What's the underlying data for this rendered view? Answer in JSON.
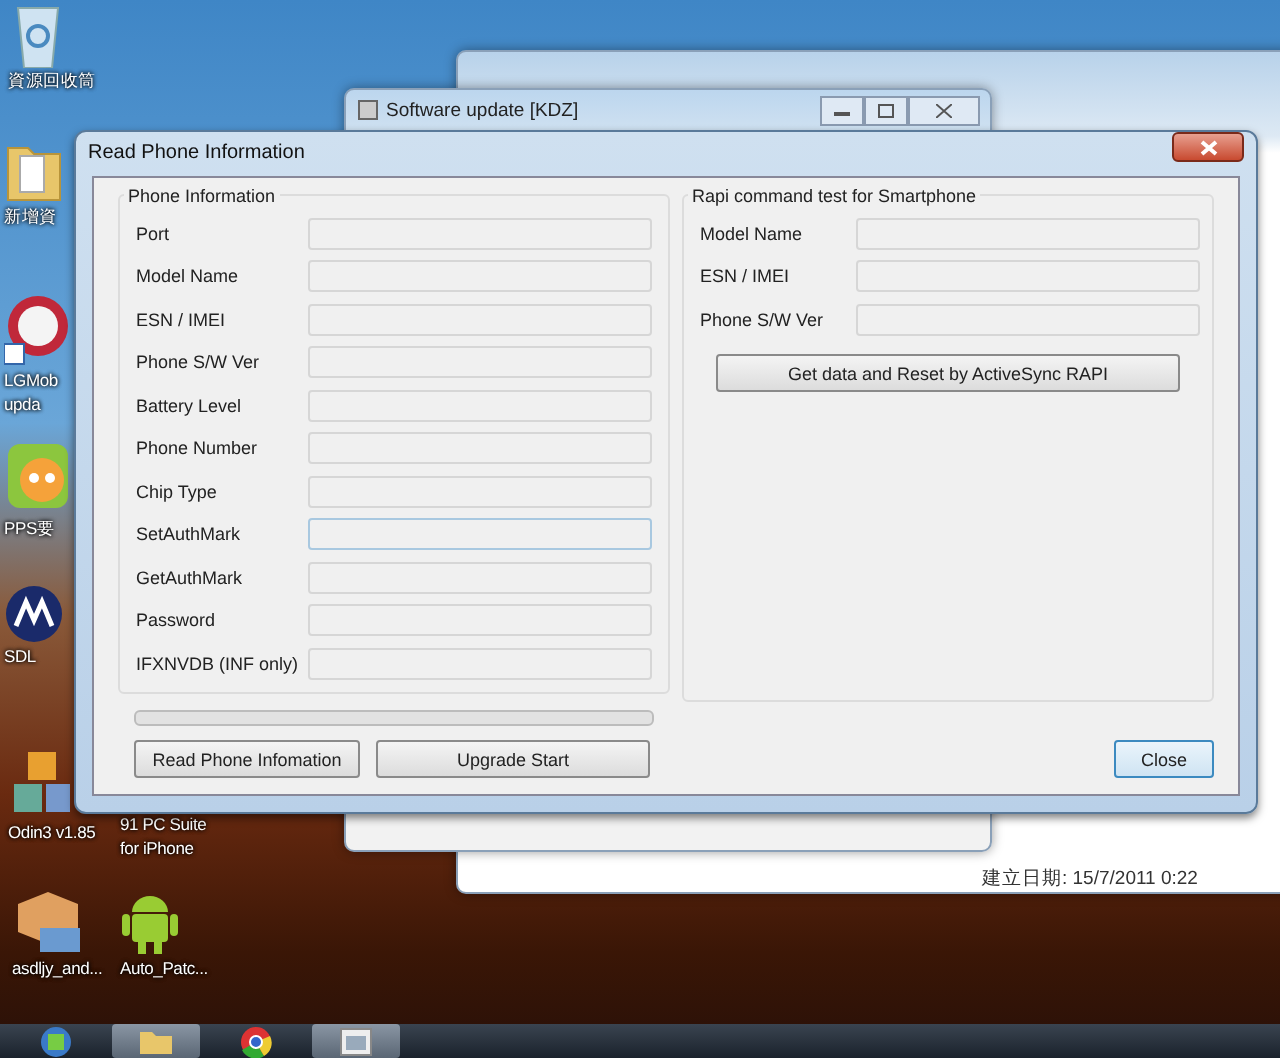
{
  "desktop_icons": [
    {
      "kind": "recycle",
      "lines": [
        "資源回收筒"
      ]
    },
    {
      "kind": "folder",
      "lines": [
        "新增資"
      ]
    },
    {
      "kind": "lg",
      "lines": [
        "LGMob",
        "upda"
      ]
    },
    {
      "kind": "pps",
      "lines": [
        "PPS要"
      ]
    },
    {
      "kind": "moto",
      "lines": [
        "SDL"
      ]
    },
    {
      "kind": "odin",
      "lines": [
        "Odin3 v1.85"
      ]
    },
    {
      "kind": "none",
      "lines": [
        "91 PC Suite",
        "for iPhone"
      ]
    },
    {
      "kind": "apk",
      "lines": [
        "asdljy_and..."
      ]
    },
    {
      "kind": "android",
      "lines": [
        "Auto_Patc..."
      ]
    }
  ],
  "background_windows": {
    "software_update_title": "Software update [KDZ]",
    "created_date": "建立日期: 15/7/2011 0:22"
  },
  "dialog": {
    "title": "Read Phone Information",
    "phone_information": {
      "title": "Phone Information",
      "fields": [
        {
          "label": "Port",
          "focused": false
        },
        {
          "label": "Model Name",
          "focused": false
        },
        {
          "label": "ESN / IMEI",
          "focused": false
        },
        {
          "label": "Phone S/W Ver",
          "focused": false
        },
        {
          "label": "Battery Level",
          "focused": false
        },
        {
          "label": "Phone Number",
          "focused": false
        },
        {
          "label": "Chip Type",
          "focused": false
        },
        {
          "label": "SetAuthMark",
          "focused": true
        },
        {
          "label": "GetAuthMark",
          "focused": false
        },
        {
          "label": "Password",
          "focused": false
        },
        {
          "label": "IFXNVDB (INF only)",
          "focused": false
        }
      ]
    },
    "rapi": {
      "title": "Rapi command test for Smartphone",
      "fields": [
        {
          "label": "Model Name",
          "focused": false
        },
        {
          "label": "ESN / IMEI",
          "focused": false
        },
        {
          "label": "Phone S/W Ver",
          "focused": false
        }
      ],
      "button": "Get data and Reset by ActiveSync RAPI"
    },
    "progress": {
      "level": 0
    },
    "buttons": [
      {
        "label": "Read Phone Infomation",
        "default": false
      },
      {
        "label": "Upgrade Start",
        "default": false
      },
      {
        "label": "Close",
        "default": true
      }
    ]
  },
  "taskbar": [
    {
      "kind": "start",
      "active": false
    },
    {
      "kind": "folder",
      "active": true
    },
    {
      "kind": "chrome",
      "active": false
    },
    {
      "kind": "app",
      "active": true
    }
  ]
}
